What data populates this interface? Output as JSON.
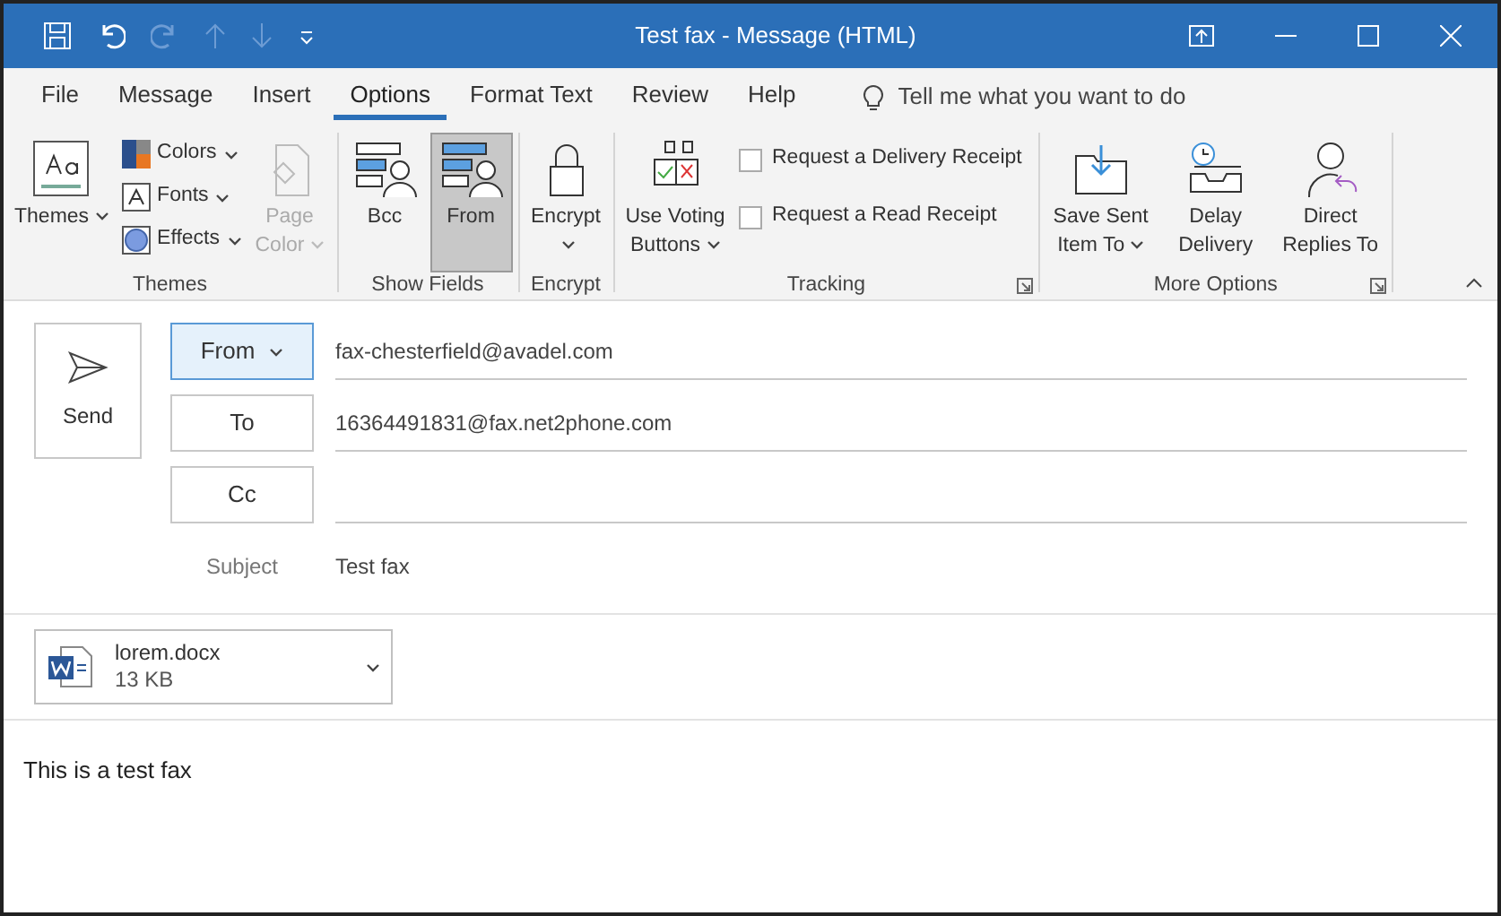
{
  "window": {
    "title": "Test fax - Message (HTML)"
  },
  "menu": [
    {
      "label": "File",
      "selected": false
    },
    {
      "label": "Message",
      "selected": false
    },
    {
      "label": "Insert",
      "selected": false
    },
    {
      "label": "Options",
      "selected": true
    },
    {
      "label": "Format Text",
      "selected": false
    },
    {
      "label": "Review",
      "selected": false
    },
    {
      "label": "Help",
      "selected": false
    }
  ],
  "tell_me": {
    "placeholder": "Tell me what you want to do"
  },
  "ribbon": [
    {
      "label": "Themes",
      "launcher": false,
      "items": [
        {
          "kind": "large",
          "label": "Themes",
          "dropdown": true,
          "disabled": false,
          "selected": false
        },
        {
          "kind": "stack",
          "items": [
            {
              "label": "Colors",
              "dropdown": true
            },
            {
              "label": "Fonts",
              "dropdown": true
            },
            {
              "label": "Effects",
              "dropdown": true
            }
          ]
        },
        {
          "kind": "large",
          "label": "Page Color",
          "dropdown": true,
          "disabled": true,
          "selected": false
        }
      ]
    },
    {
      "label": "Show Fields",
      "launcher": false,
      "items": [
        {
          "kind": "large",
          "label": "Bcc",
          "dropdown": false,
          "disabled": false,
          "selected": false
        },
        {
          "kind": "large",
          "label": "From",
          "dropdown": false,
          "disabled": false,
          "selected": true
        }
      ]
    },
    {
      "label": "Encrypt",
      "launcher": false,
      "items": [
        {
          "kind": "large",
          "label": "Encrypt",
          "dropdown": true,
          "disabled": false,
          "selected": false
        }
      ]
    },
    {
      "label": "Tracking",
      "launcher": true,
      "items": [
        {
          "kind": "large",
          "label": "Use Voting Buttons",
          "dropdown": true,
          "disabled": false,
          "selected": false
        },
        {
          "kind": "checks",
          "items": [
            {
              "label": "Request a Delivery Receipt",
              "checked": false
            },
            {
              "label": "Request a Read Receipt",
              "checked": false
            }
          ]
        }
      ]
    },
    {
      "label": "More Options",
      "launcher": true,
      "items": [
        {
          "kind": "large",
          "label": "Save Sent Item To",
          "dropdown": true,
          "disabled": false,
          "selected": false
        },
        {
          "kind": "large",
          "label": "Delay Delivery",
          "dropdown": false,
          "disabled": false,
          "selected": false
        },
        {
          "kind": "large",
          "label": "Direct Replies To",
          "dropdown": false,
          "disabled": false,
          "selected": false
        }
      ]
    }
  ],
  "compose": {
    "send": "Send",
    "fields": [
      {
        "kind": "button",
        "label": "From",
        "dropdown": true,
        "active": true,
        "value": "fax-chesterfield@avadel.com"
      },
      {
        "kind": "button",
        "label": "To",
        "dropdown": false,
        "active": false,
        "value": "16364491831@fax.net2phone.com"
      },
      {
        "kind": "button",
        "label": "Cc",
        "dropdown": false,
        "active": false
      },
      {
        "kind": "plain",
        "label": "Subject",
        "value": "Test fax"
      }
    ],
    "attachment": {
      "name": "lorem.docx",
      "size": "13 KB"
    },
    "body": "This is a test fax"
  }
}
